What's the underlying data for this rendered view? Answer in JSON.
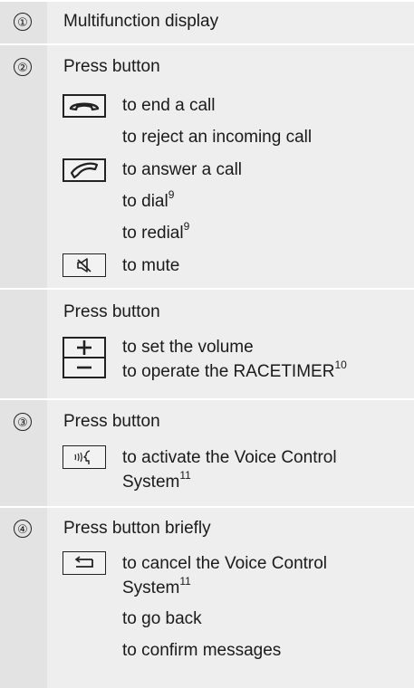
{
  "rows": [
    {
      "marker": "①",
      "title": "Multifunction display"
    },
    {
      "marker": "②",
      "title": "Press button",
      "items": [
        {
          "icon": "end-call-icon",
          "actions": [
            "to end a call",
            "to reject an incoming call"
          ]
        },
        {
          "icon": "answer-call-icon",
          "actions": [
            "to answer a call",
            "to dial",
            "to redial"
          ],
          "footnotes": [
            "",
            "9",
            "9"
          ]
        },
        {
          "icon": "mute-icon",
          "actions": [
            "to mute"
          ]
        }
      ]
    },
    {
      "marker": "",
      "title": "Press button",
      "items": [
        {
          "icon": "plus-icon",
          "actions": [
            "to set the volume"
          ]
        },
        {
          "icon": "minus-icon",
          "actions": [
            "to operate the RACETIMER"
          ],
          "footnotes": [
            "10"
          ]
        }
      ]
    },
    {
      "marker": "③",
      "title": "Press button",
      "items": [
        {
          "icon": "voice-control-icon",
          "lines": [
            "to activate the Voice Control",
            "System"
          ],
          "footnote": "11"
        }
      ]
    },
    {
      "marker": "④",
      "title": "Press button briefly",
      "items": [
        {
          "icon": "back-icon",
          "lines": [
            "to cancel the Voice Control",
            "System"
          ],
          "footnote": "11",
          "actions": [
            "to go back",
            "to confirm messages"
          ]
        }
      ]
    }
  ]
}
